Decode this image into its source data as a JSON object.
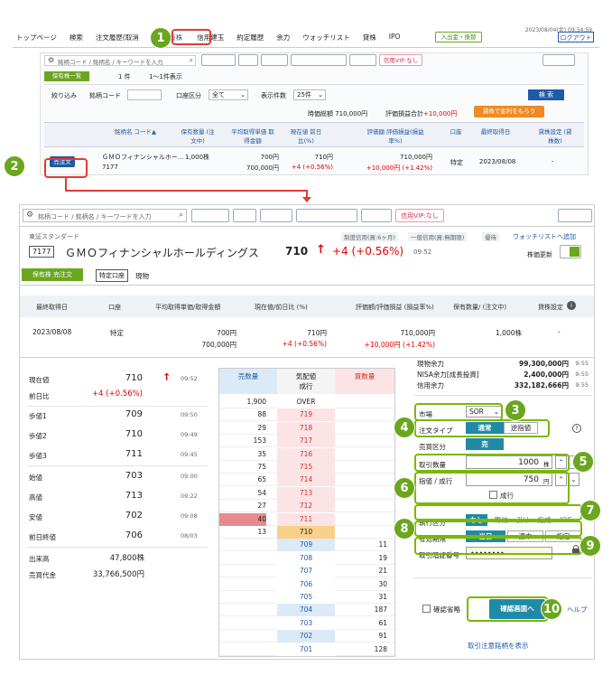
{
  "top": {
    "timestamp": "2023/08/04(金) 09:54:59",
    "nav": [
      "トップページ",
      "検索",
      "注文履歴(取消",
      "保有株",
      "信用建玉",
      "約定履歴",
      "余力",
      "ウォッチリスト",
      "貸株",
      "IPO"
    ],
    "deposit": "入出金・振替",
    "logout": "ログアウト",
    "search_ph": "銘柄コード / 銘柄名 / キーワードを入力",
    "tool_btns": [
      "条件検索",
      "優待",
      "一般売",
      "スクリーニング",
      "ヘルプ",
      "信用VIP:なし"
    ],
    "refresh": "更新",
    "list_label": "保有株一覧",
    "count": "1 件",
    "range": "1〜1件表示",
    "filter": "絞り込み",
    "code_label": "銘柄コード",
    "account_label": "口座区分",
    "account_val": "全て",
    "per_page_label": "表示件数",
    "per_page_val": "25件",
    "search_btn": "検 索",
    "total": "時価総額 710,000円",
    "pl_total_label": "評価損益合計",
    "pl_total": "+10,000円",
    "lend_btn": "貸株で金利をもらう",
    "headers": [
      "銘柄名 コード▲",
      "保有数量 (注文中)",
      "平均取得単価 取得金額",
      "現在値 前日比(%)",
      "評価額 評価損益(損益率%)",
      "口座",
      "最終取得日",
      "貸株設定 (貸株数)"
    ],
    "row": {
      "sell": "売注文",
      "name": "ＧＭＯフィナンシャルホー...",
      "code": "7177",
      "qty": "1,000株",
      "avg": "700円",
      "cost": "700,000円",
      "price": "710円",
      "chg": "+4 (+0.56%)",
      "val": "710,000円",
      "pl": "+10,000円 (+1.42%)",
      "acct": "特定",
      "date": "2023/08/08",
      "lend": "-"
    }
  },
  "bottom": {
    "search_ph": "銘柄コード / 銘柄名 / キーワードを入力",
    "tool_btns": [
      "条件検索",
      "優待",
      "一般売",
      "スクリーニング",
      "ヘルプ",
      "信用VIP:なし"
    ],
    "refresh": "更新",
    "market": "東証スタンダード",
    "badges": [
      "制度信用(買:6ヶ月)",
      "一般信用(買:無期限)",
      "優待"
    ],
    "watch": "ウォッチリストへ追加",
    "code": "7177",
    "name": "ＧＭＯフィナンシャルホールディングス",
    "price": "710",
    "chg": "+4 (+0.56%)",
    "time": "09:52",
    "auto_update": "株価更新",
    "tab_active": "保有株 売注文",
    "tab2": "特定口座",
    "tab3": "現物",
    "hold_headers": [
      "最終取得日",
      "口座",
      "平均取得単価/取得金額",
      "現在値/前日比 (%)",
      "評価額/評価損益 (損益率%)",
      "保有数量/ (注文中)",
      "貸株設定"
    ],
    "hold": {
      "date": "2023/08/08",
      "acct": "特定",
      "avg": "700円",
      "cost": "700,000円",
      "price": "710円",
      "chg": "+4 (+0.56%)",
      "val": "710,000円",
      "pl": "+10,000円 (+1.42%)",
      "qty": "1,000株",
      "lend": "-"
    },
    "quote": [
      {
        "l": "現在値",
        "v": "710",
        "t": "09:52"
      },
      {
        "l": "前日比",
        "v": "+4 (+0.56%)",
        "t": ""
      },
      {
        "l": "歩値1",
        "v": "709",
        "t": "09:50"
      },
      {
        "l": "歩値2",
        "v": "710",
        "t": "09:49"
      },
      {
        "l": "歩値3",
        "v": "711",
        "t": "09:45"
      },
      {
        "l": "始値",
        "v": "703",
        "t": "09:00"
      },
      {
        "l": "高値",
        "v": "713",
        "t": "09:22"
      },
      {
        "l": "安値",
        "v": "702",
        "t": "09:08"
      },
      {
        "l": "前日終値",
        "v": "706",
        "t": "08/03"
      },
      {
        "l": "出来高",
        "v": "47,800株",
        "t": ""
      },
      {
        "l": "売買代金",
        "v": "33,766,500円",
        "t": ""
      }
    ],
    "book_headers": [
      "売数量",
      "気配値 成行",
      "買数量"
    ],
    "book": [
      {
        "s": "1,900",
        "p": "OVER",
        "b": ""
      },
      {
        "s": "88",
        "p": "719",
        "b": ""
      },
      {
        "s": "29",
        "p": "718",
        "b": ""
      },
      {
        "s": "153",
        "p": "717",
        "b": ""
      },
      {
        "s": "35",
        "p": "716",
        "b": ""
      },
      {
        "s": "75",
        "p": "715",
        "b": ""
      },
      {
        "s": "65",
        "p": "714",
        "b": ""
      },
      {
        "s": "54",
        "p": "713",
        "b": ""
      },
      {
        "s": "27",
        "p": "712",
        "b": ""
      },
      {
        "s": "40",
        "p": "711",
        "b": ""
      },
      {
        "s": "13",
        "p": "710",
        "b": ""
      },
      {
        "s": "",
        "p": "709",
        "b": "11"
      },
      {
        "s": "",
        "p": "708",
        "b": "19"
      },
      {
        "s": "",
        "p": "707",
        "b": "21"
      },
      {
        "s": "",
        "p": "706",
        "b": "30"
      },
      {
        "s": "",
        "p": "705",
        "b": "31"
      },
      {
        "s": "",
        "p": "704",
        "b": "187"
      },
      {
        "s": "",
        "p": "703",
        "b": "61"
      },
      {
        "s": "",
        "p": "702",
        "b": "91"
      },
      {
        "s": "",
        "p": "701",
        "b": "128"
      }
    ],
    "funds": [
      {
        "l": "現物余力",
        "v": "99,300,000円",
        "t": "9:55"
      },
      {
        "l": "NISA余力[成長投資]",
        "v": "2,400,000円",
        "t": "9:55"
      },
      {
        "l": "信用余力",
        "v": "332,182,666円",
        "t": "9:55"
      }
    ],
    "form": {
      "market_l": "市場",
      "market_v": "SOR",
      "type_l": "注文タイプ",
      "type_a": "通常",
      "type_b": "逆指値",
      "side_l": "売買区分",
      "side_v": "売",
      "qty_l": "取引数量",
      "qty_v": "1000",
      "qty_u": "株",
      "price_l": "指値 / 成行",
      "price_v": "750",
      "price_u": "円",
      "market_order": "成行",
      "exec_l": "執行区分",
      "exec_opts": [
        "なし",
        "寄付",
        "引け",
        "指成",
        "IOC"
      ],
      "valid_l": "有効期限",
      "valid_opts": [
        "当日",
        "週末",
        "指定"
      ],
      "pw_l": "取引暗証番号",
      "pw_v": "••••••••",
      "skip": "確認省略",
      "confirm": "確認画面へ",
      "help": "ヘルプ",
      "caution": "取引注意銘柄を表示"
    }
  },
  "callouts": [
    "1",
    "2",
    "3",
    "4",
    "5",
    "6",
    "7",
    "8",
    "9",
    "10"
  ]
}
